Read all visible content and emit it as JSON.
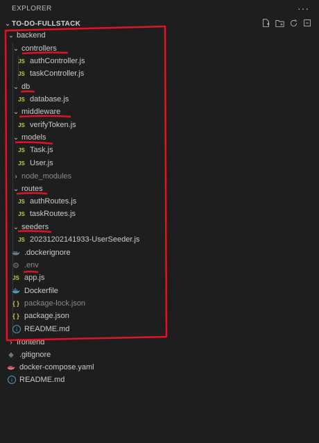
{
  "header": {
    "title": "EXPLORER",
    "more_icon": "ellipsis-icon"
  },
  "project": {
    "name": "TO-DO-FULLSTACK",
    "actions": [
      "new-file-icon",
      "new-folder-icon",
      "refresh-icon",
      "collapse-all-icon"
    ]
  },
  "tree": {
    "backend": "backend",
    "controllers": "controllers",
    "authController": "authController.js",
    "taskController": "taskController.js",
    "db": "db",
    "database": "database.js",
    "middleware": "middleware",
    "verifyToken": "verifyToken.js",
    "models": "models",
    "task_model": "Task.js",
    "user_model": "User.js",
    "node_modules": "node_modules",
    "routes": "routes",
    "authRoutes": "authRoutes.js",
    "taskRoutes": "taskRoutes.js",
    "seeders": "seeders",
    "userSeeder": "20231202141933-UserSeeder.js",
    "dockerignore": ".dockerignore",
    "env": ".env",
    "app": "app.js",
    "dockerfile": "Dockerfile",
    "package_lock": "package-lock.json",
    "package": "package.json",
    "readme_backend": "README.md",
    "frontend": "frontend",
    "gitignore": ".gitignore",
    "docker_compose": "docker-compose.yaml",
    "readme_root": "README.md"
  },
  "icons": {
    "js_glyph": "JS",
    "json_glyph": "{ }",
    "info_glyph": "i"
  },
  "colors": {
    "background": "#1e1e1e",
    "text": "#cccccc",
    "js_icon": "#cbcb41",
    "docker_icon": "#519aba",
    "annotation_red": "#e81123"
  }
}
